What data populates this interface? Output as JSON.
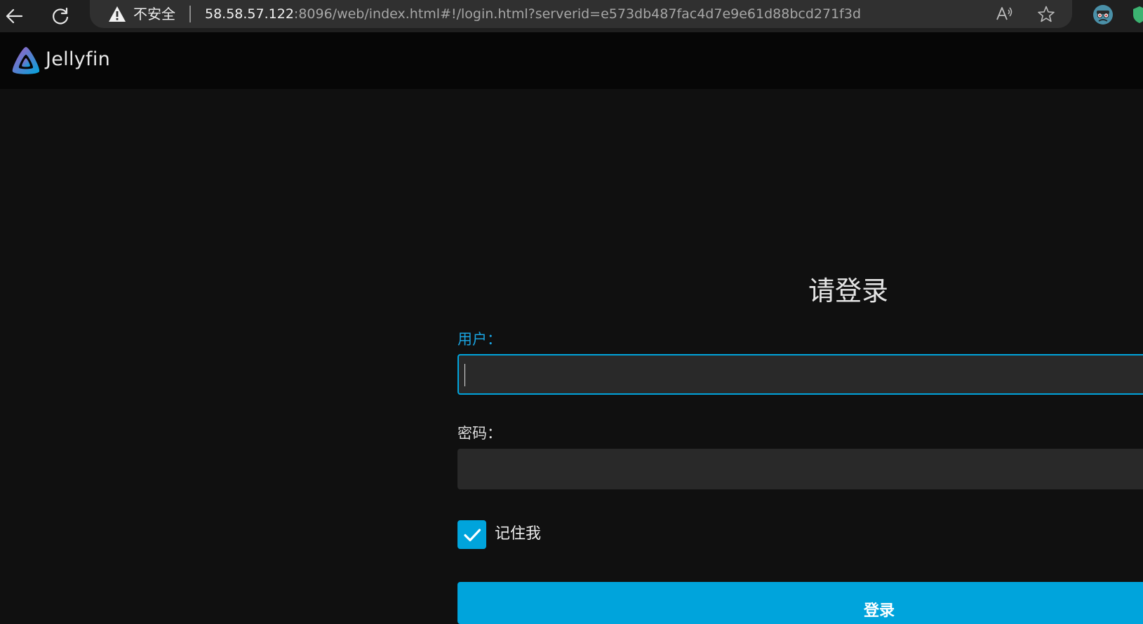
{
  "browser": {
    "security_label": "不安全",
    "url_host": "58.58.57.122",
    "url_rest": ":8096/web/index.html#!/login.html?serverid=e573db487fac4d7e9e61d88bcd271f3d",
    "icons": [
      "back-arrow-icon",
      "reload-icon",
      "warning-icon",
      "read-aloud-icon",
      "favorite-star-icon",
      "profile-icon"
    ]
  },
  "app": {
    "brand": "Jellyfin",
    "logo_colors": [
      "#aa5cc3",
      "#00a4dc"
    ]
  },
  "login": {
    "title": "请登录",
    "username_label": "用户：",
    "username_value": "",
    "password_label": "密码：",
    "password_value": "",
    "remember_me_label": "记住我",
    "remember_me_checked": true,
    "submit_label": "登录"
  },
  "colors": {
    "accent": "#00a4dc",
    "background": "#101010",
    "header": "#060606",
    "input": "#292929"
  }
}
